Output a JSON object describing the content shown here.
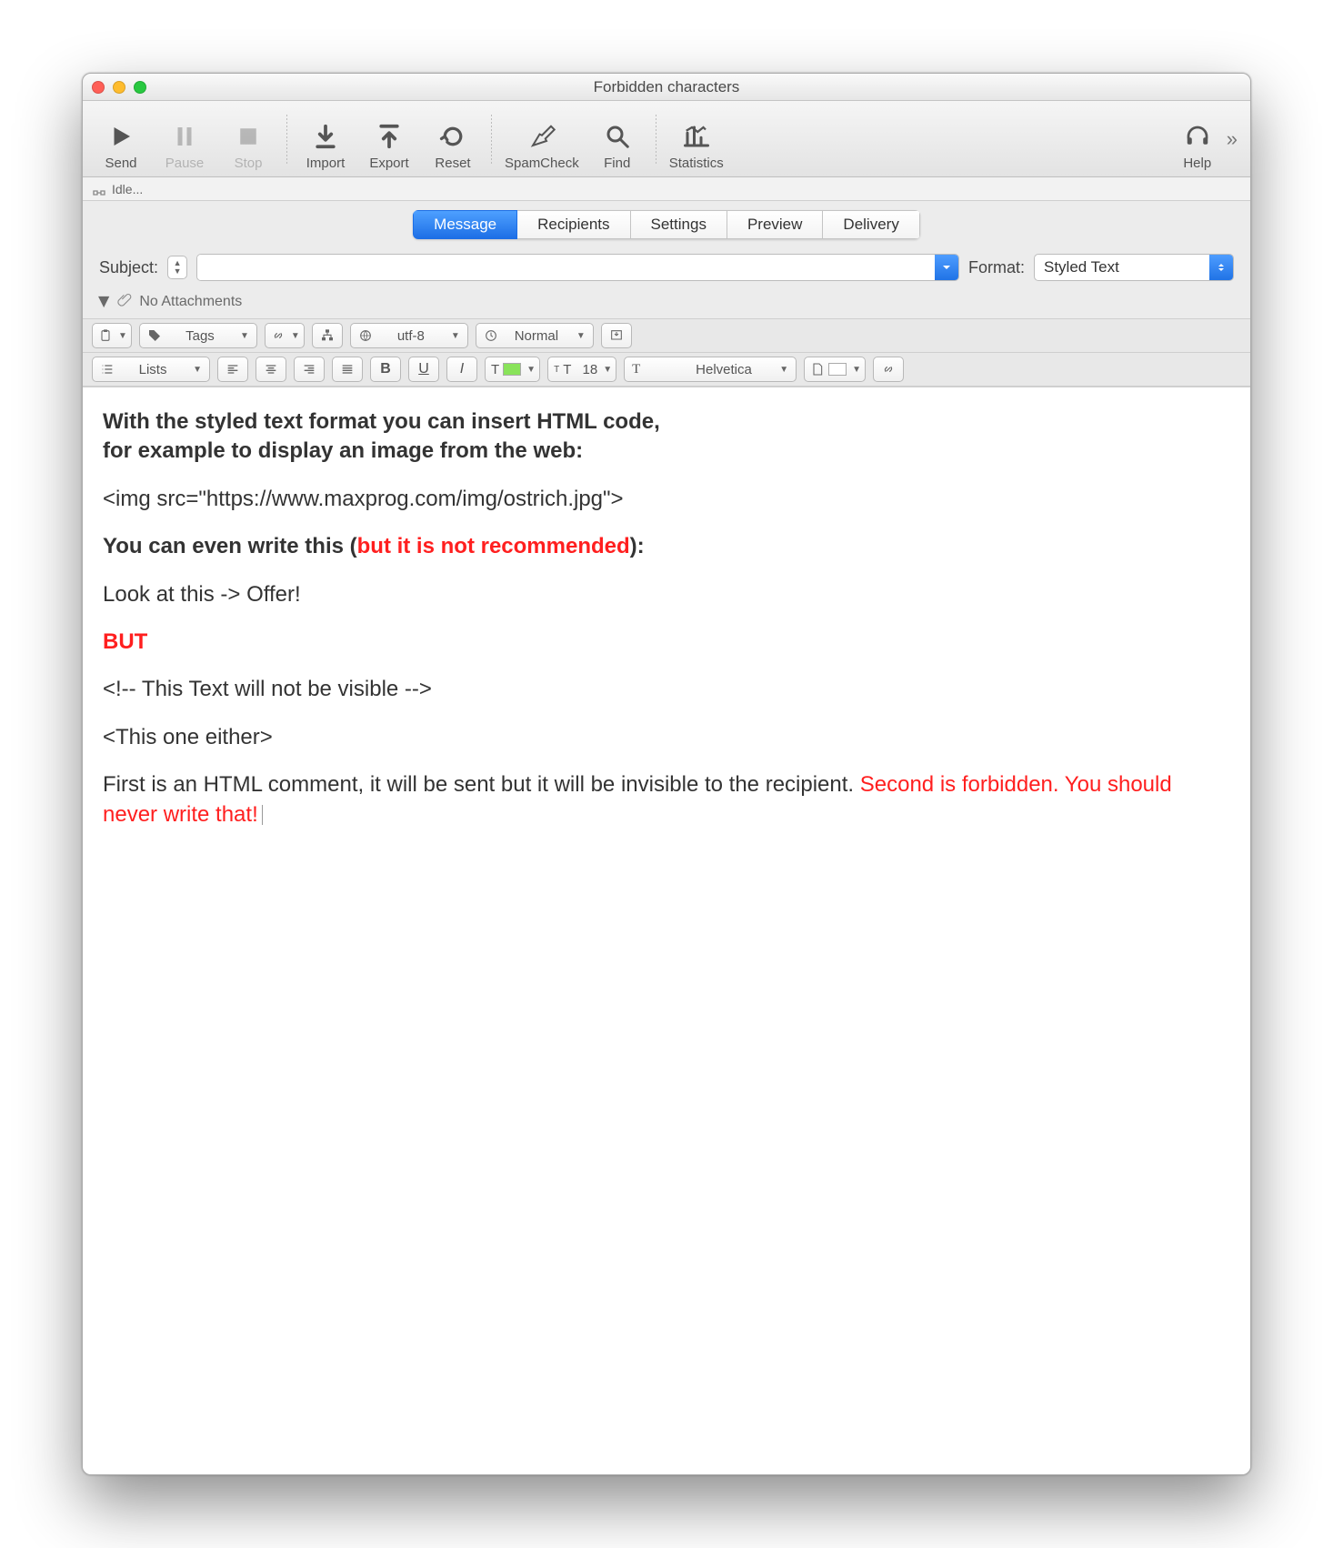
{
  "window": {
    "title": "Forbidden characters"
  },
  "toolbar": {
    "send": "Send",
    "pause": "Pause",
    "stop": "Stop",
    "import": "Import",
    "export": "Export",
    "reset": "Reset",
    "spamcheck": "SpamCheck",
    "find": "Find",
    "statistics": "Statistics",
    "help": "Help"
  },
  "status": {
    "text": "Idle..."
  },
  "tabs": {
    "message": "Message",
    "recipients": "Recipients",
    "settings": "Settings",
    "preview": "Preview",
    "delivery": "Delivery"
  },
  "subject": {
    "label": "Subject:",
    "value": ""
  },
  "format": {
    "label": "Format:",
    "value": "Styled Text"
  },
  "attachments": {
    "text": "No Attachments"
  },
  "fmt": {
    "tags": "Tags",
    "encoding": "utf-8",
    "priority": "Normal",
    "lists": "Lists",
    "fontsize": "18",
    "font": "Helvetica"
  },
  "body": {
    "l1": "With the styled text format you can insert HTML code,",
    "l2": "for example to display an image from the web:",
    "l3": "<img src=\"https://www.maxprog.com/img/ostrich.jpg\">",
    "l4a": "You can even write this (",
    "l4b": "but it is not recommended",
    "l4c": "):",
    "l5": "Look at this -> Offer!",
    "l6": "BUT",
    "l7": "<!-- This Text will not be visible -->",
    "l8": "<This one either>",
    "l9a": "First is an HTML comment, it will be sent but it will be invisible to the recipient. ",
    "l9b": "Second is forbidden. You should never write that!"
  }
}
